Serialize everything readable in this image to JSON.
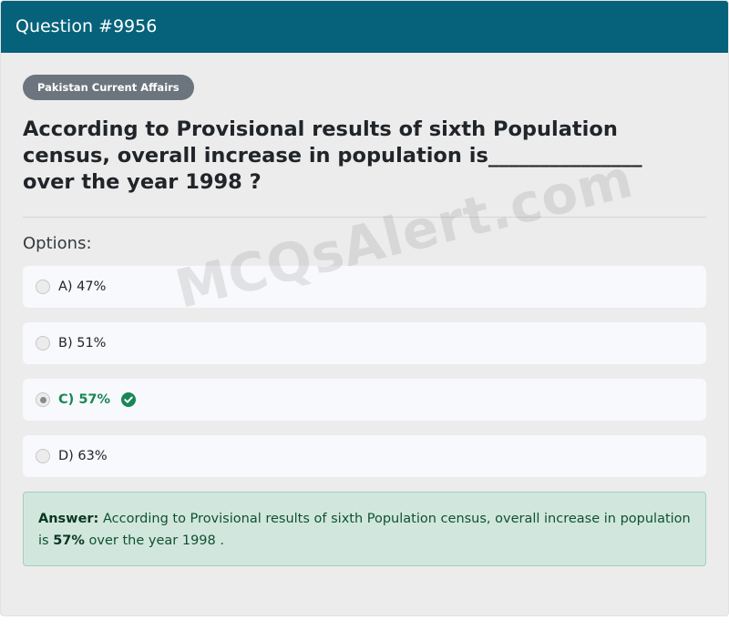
{
  "header": {
    "title": "Question #9956"
  },
  "category_badge": "Pakistan Current Affairs",
  "question": {
    "text": "According to Provisional results of sixth Population census, overall increase in population is_______________ over the year 1998 ?"
  },
  "options_label": "Options:",
  "options": [
    {
      "label": "A) 47%",
      "selected": false,
      "correct": false
    },
    {
      "label": "B) 51%",
      "selected": false,
      "correct": false
    },
    {
      "label": "C) 57%",
      "selected": true,
      "correct": true,
      "icon": "check-circle-icon"
    },
    {
      "label": "D) 63%",
      "selected": false,
      "correct": false
    }
  ],
  "answer": {
    "label": "Answer:",
    "text_before": "According to Provisional results of sixth Population census, overall increase in population is",
    "highlight": "57%",
    "text_after": "over the year 1998 ."
  },
  "watermark": "MCQsAlert.com",
  "colors": {
    "header_bg": "#05627a",
    "badge_bg": "#6c757d",
    "correct_green": "#198754",
    "answer_bg": "#d1e7dd"
  }
}
